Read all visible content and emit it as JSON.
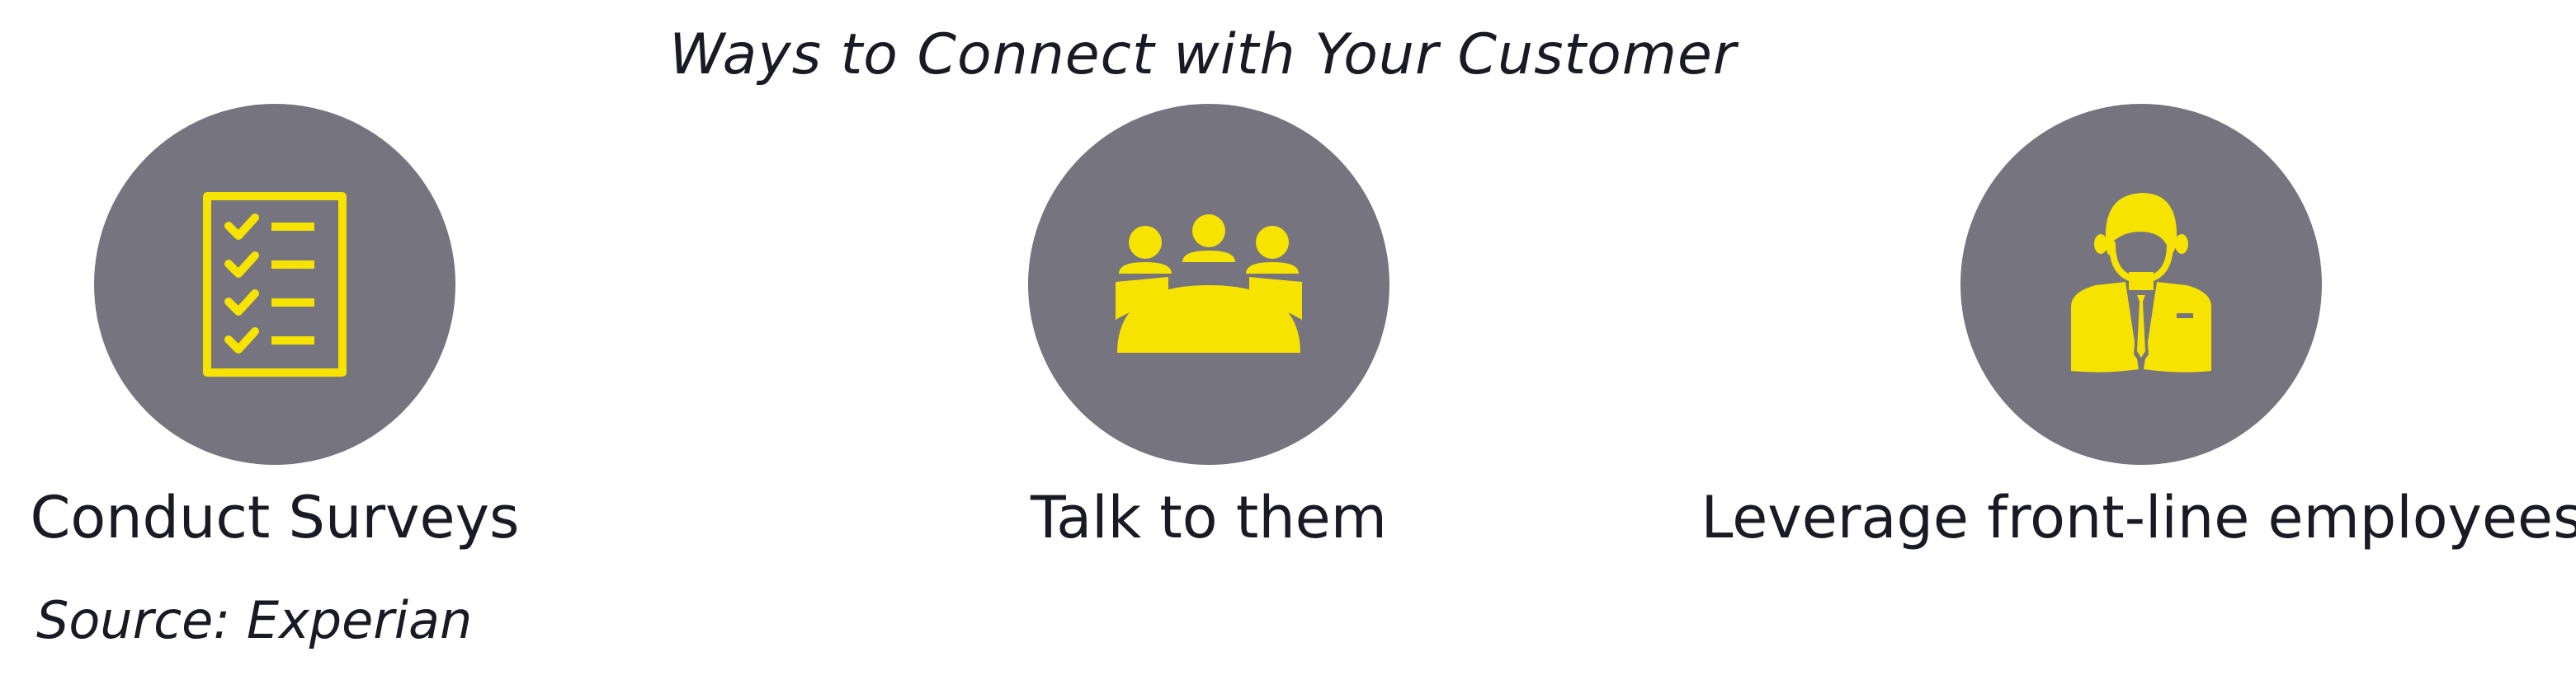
{
  "title": "Ways to Connect with Your Customer",
  "colors": {
    "circle": "#75747f",
    "icon": "#f7e300",
    "text": "#1a1a24"
  },
  "items": [
    {
      "label": "Conduct Surveys",
      "icon": "checklist-icon"
    },
    {
      "label": "Talk to them",
      "icon": "meeting-table-icon"
    },
    {
      "label": "Leverage front-line employees",
      "icon": "employee-icon"
    }
  ],
  "source": "Source: Experian"
}
